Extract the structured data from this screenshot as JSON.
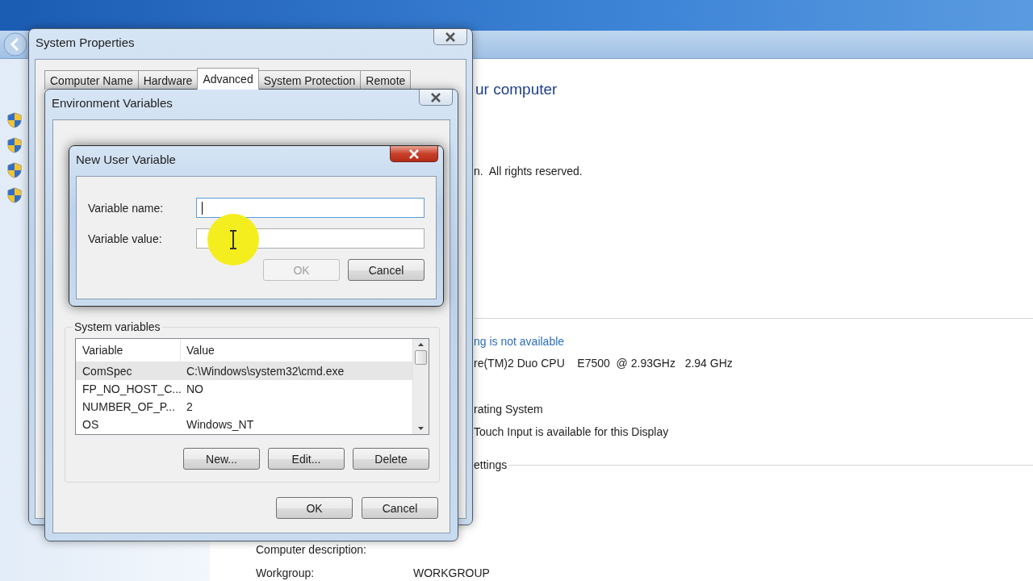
{
  "background_window": {
    "heading": "ur computer",
    "copyright": "n.  All rights reserved.",
    "rating_link": "ng is not available",
    "processor": "re(TM)2 Duo CPU    E7500  @ 2.93GHz   2.94 GHz",
    "system_type": "rating System",
    "pen_touch": "Touch Input is available for this Display",
    "section": "ettings",
    "details": [
      {
        "label": "Computer description:"
      },
      {
        "label": "Workgroup:",
        "value": "WORKGROUP"
      }
    ]
  },
  "system_properties": {
    "title": "System Properties",
    "tabs": [
      {
        "label": "Computer Name",
        "selected": false
      },
      {
        "label": "Hardware",
        "selected": false
      },
      {
        "label": "Advanced",
        "selected": true
      },
      {
        "label": "System Protection",
        "selected": false
      },
      {
        "label": "Remote",
        "selected": false
      }
    ]
  },
  "environment_variables": {
    "title": "Environment Variables",
    "system_variables": {
      "label": "System variables",
      "columns": [
        "Variable",
        "Value"
      ],
      "rows": [
        {
          "variable": "ComSpec",
          "value": "C:\\Windows\\system32\\cmd.exe",
          "selected": true
        },
        {
          "variable": "FP_NO_HOST_C...",
          "value": "NO",
          "selected": false
        },
        {
          "variable": "NUMBER_OF_P...",
          "value": "2",
          "selected": false
        },
        {
          "variable": "OS",
          "value": "Windows_NT",
          "selected": false
        }
      ],
      "buttons": [
        "New...",
        "Edit...",
        "Delete"
      ]
    },
    "buttons": [
      "OK",
      "Cancel"
    ]
  },
  "new_user_variable": {
    "title": "New User Variable",
    "fields": [
      {
        "label": "Variable name:",
        "focused": true
      },
      {
        "label": "Variable value:",
        "focused": false
      }
    ],
    "buttons": [
      {
        "label": "OK",
        "disabled": true
      },
      {
        "label": "Cancel",
        "disabled": false
      }
    ]
  }
}
